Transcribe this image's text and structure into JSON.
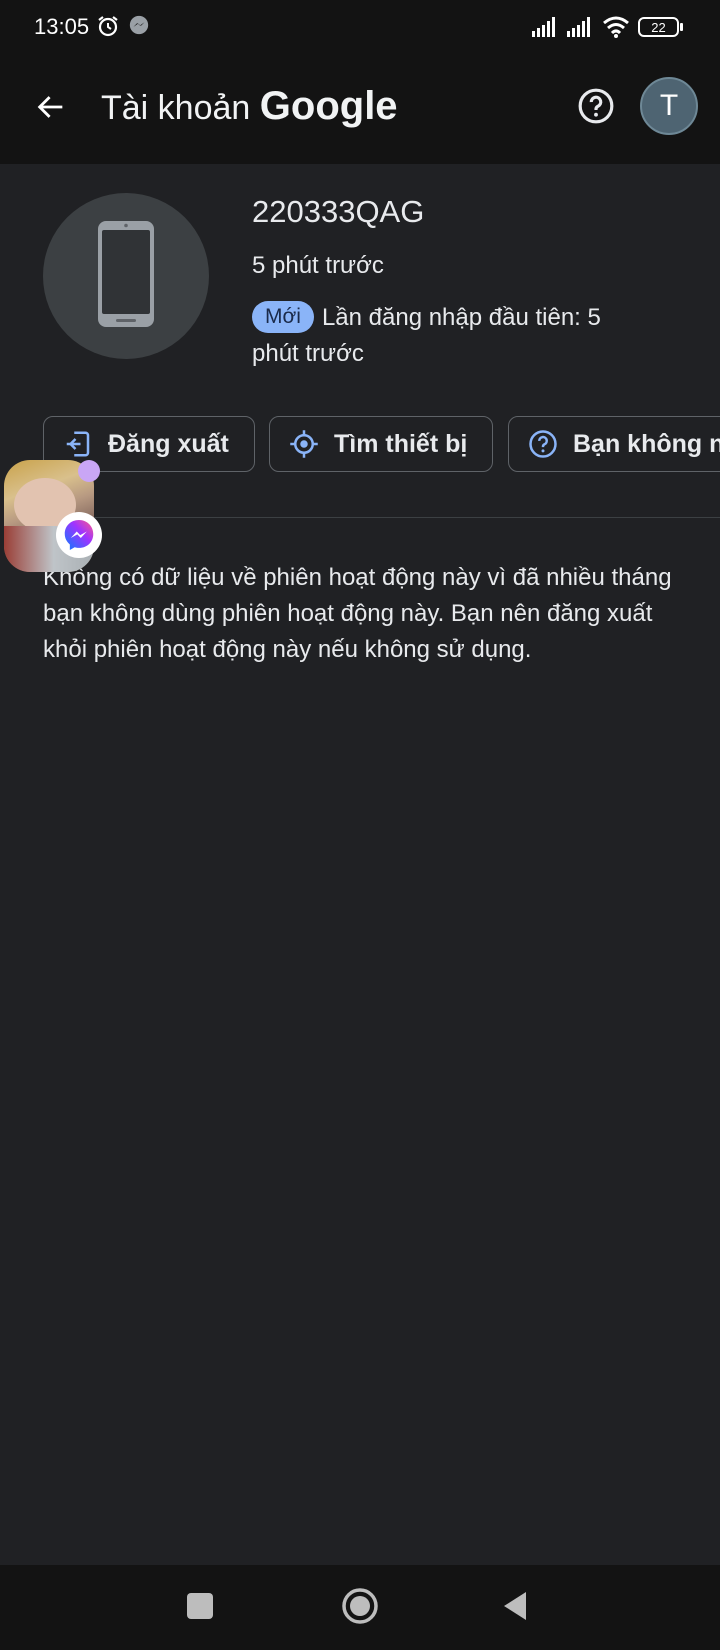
{
  "status_bar": {
    "time": "13:05",
    "battery": "22",
    "icons": [
      "alarm-icon",
      "messenger-notification-icon",
      "signal-icon",
      "signal-icon",
      "wifi-icon",
      "battery-icon"
    ]
  },
  "app_bar": {
    "title_prefix": "Tài khoản",
    "title_brand": "Google",
    "avatar_letter": "T",
    "back_icon": "arrow-back-icon",
    "help_icon": "help-circle-icon"
  },
  "device": {
    "name": "220333QAG",
    "last_active": "5 phút trước",
    "badge_new": "Mới",
    "first_login": "Lần đăng nhập đầu tiên: 5 phút trước",
    "icon": "phone-icon"
  },
  "actions": {
    "logout": "Đăng xuất",
    "find_device": "Tìm thiết bị",
    "unknown": "Bạn không nh"
  },
  "note": "Không có dữ liệu về phiên hoạt động này vì đã nhiều tháng bạn không dùng phiên hoạt động này. Bạn nên đăng xuất khỏi phiên hoạt động này nếu không sử dụng.",
  "colors": {
    "background": "#202124",
    "bar": "#131313",
    "accent": "#8ab4f8",
    "chip_border": "#5f6368"
  }
}
